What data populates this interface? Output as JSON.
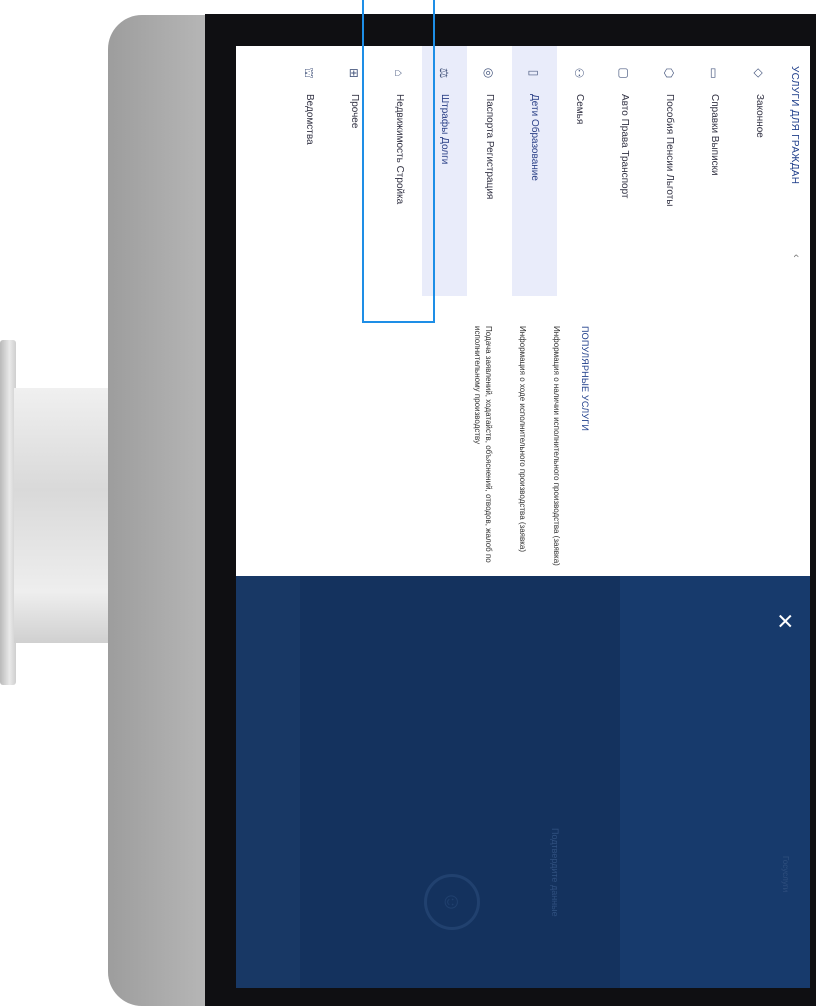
{
  "menu": {
    "title": "УСЛУГИ ДЛЯ ГРАЖДАН",
    "caret": "‹",
    "items": [
      {
        "label": "Законное",
        "icon": "diamond-icon"
      },
      {
        "label": "Справки Выписки",
        "icon": "folder-icon"
      },
      {
        "label": "Пособия Пенсии Льготы",
        "icon": "shield-icon"
      },
      {
        "label": "Авто Права Транспорт",
        "icon": "car-icon"
      },
      {
        "label": "Семья",
        "icon": "family-icon"
      },
      {
        "label": "Дети Образование",
        "icon": "book-icon"
      },
      {
        "label": "Паспорта Регистрация",
        "icon": "passport-icon"
      },
      {
        "label": "Штрафы Долги",
        "icon": "fine-icon"
      },
      {
        "label": "Недвижимость Стройка",
        "icon": "house-icon"
      },
      {
        "label": "Прочее",
        "icon": "grid-icon"
      },
      {
        "label": "Ведомства",
        "icon": "building-icon"
      }
    ]
  },
  "content": {
    "section_title": "ПОПУЛЯРНЫЕ УСЛУГИ",
    "services": [
      "Информация о наличии исполнительного производства (заявка)",
      "Информация о ходе исполнительного производства (заявка)",
      "Подача заявлений, ходатайств, объяснений, отводов, жалоб по исполнительному производству"
    ]
  },
  "overlay": {
    "close_label": "×",
    "caption": "Подтвердите данные",
    "corner_text": "Госуслуги",
    "logo_glyph": "☺"
  },
  "colors": {
    "accent": "#1f3e8a",
    "overlay": "#14325e",
    "highlight": "#1e8ee6",
    "selected": "#e9ecfa"
  }
}
